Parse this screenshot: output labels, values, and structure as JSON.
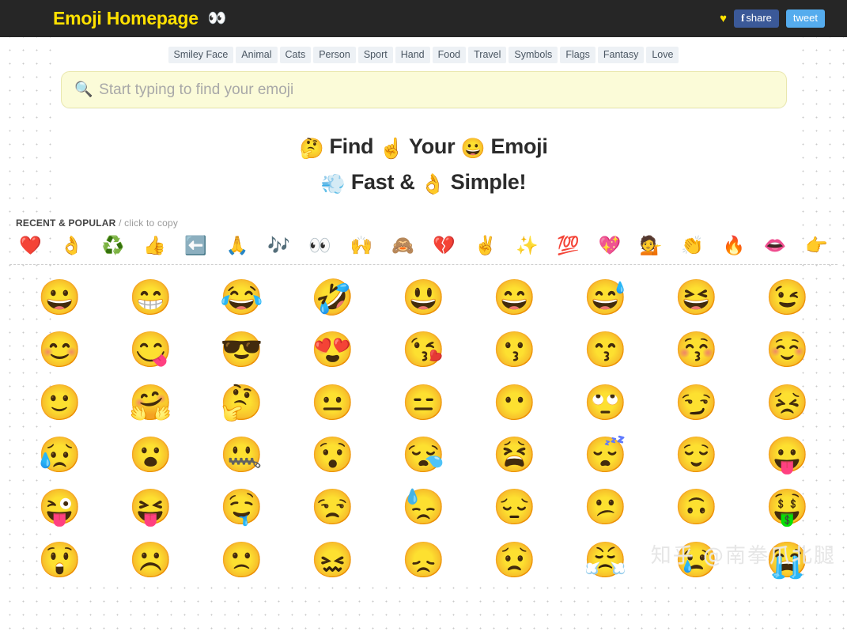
{
  "header": {
    "brand_title": "Emoji Homepage",
    "brand_icon": "👀",
    "heart_icon": "♥",
    "facebook_share_prefix": "f",
    "facebook_share_label": "share",
    "tweet_label": "tweet"
  },
  "nav": {
    "items": [
      "Smiley Face",
      "Animal",
      "Cats",
      "Person",
      "Sport",
      "Hand",
      "Food",
      "Travel",
      "Symbols",
      "Flags",
      "Fantasy",
      "Love"
    ]
  },
  "search": {
    "placeholder": "Start typing to find your emoji",
    "value": "",
    "icon": "🔎"
  },
  "headline": {
    "line1_emoji1": "🤔",
    "line1_word1": "Find",
    "line1_emoji2": "☝",
    "line1_word2": "Your",
    "line1_emoji3": "😀",
    "line1_word3": "Emoji",
    "line2_emoji1": "💨",
    "line2_word1": "Fast &",
    "line2_emoji2": "👌",
    "line2_word2": "Simple!"
  },
  "recent": {
    "title": "RECENT & POPULAR",
    "hint": "/ click to copy",
    "emojis": [
      "❤️",
      "👌",
      "♻️",
      "👍",
      "⬅️",
      "🙏",
      "🎶",
      "👀",
      "🙌",
      "🙈",
      "💔",
      "✌️",
      "✨",
      "💯",
      "💖",
      "💁",
      "👏",
      "🔥",
      "👄",
      "👉"
    ]
  },
  "grid": {
    "emojis": [
      "😀",
      "😁",
      "😂",
      "🤣",
      "😃",
      "😄",
      "😅",
      "😆",
      "😉",
      "😊",
      "😋",
      "😎",
      "😍",
      "😘",
      "😗",
      "😙",
      "😚",
      "☺️",
      "🙂",
      "🤗",
      "🤔",
      "😐",
      "😑",
      "😶",
      "🙄",
      "😏",
      "😣",
      "😥",
      "😮",
      "🤐",
      "😯",
      "😪",
      "😫",
      "😴",
      "😌",
      "😛",
      "😜",
      "😝",
      "🤤",
      "😒",
      "😓",
      "😔",
      "😕",
      "🙃",
      "🤑",
      "😲",
      "☹️",
      "🙁",
      "😖",
      "😞",
      "😟",
      "😤",
      "😢",
      "😭"
    ]
  },
  "watermark": {
    "text": "知乎 @南拳爪北腿"
  },
  "colors": {
    "topbar_bg": "#262626",
    "brand_yellow": "#ffe100",
    "facebook_blue": "#3b5998",
    "twitter_blue": "#55acee",
    "search_bg": "#fbfbd8",
    "nav_chip_bg": "#edf1f5"
  }
}
